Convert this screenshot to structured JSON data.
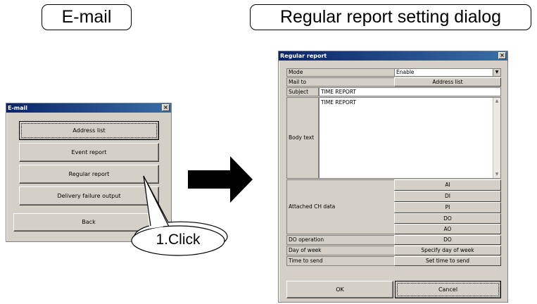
{
  "headings": {
    "left": "E-mail",
    "right": "Regular report setting dialog"
  },
  "email_dialog": {
    "title": "E-mail",
    "buttons": [
      "Address list",
      "Event report",
      "Regular report",
      "Delivery failure output"
    ],
    "back": "Back"
  },
  "callout": {
    "text": "1.Click"
  },
  "regular_dialog": {
    "title": "Regular report",
    "mode_label": "Mode",
    "mode_value": "Enable",
    "mail_to_label": "Mail to",
    "address_list_button": "Address list",
    "subject_label": "Subject",
    "subject_value": "TIME REPORT",
    "body_label": "Body text",
    "body_value": "TIME REPORT",
    "attached_label": "Attached CH data",
    "ch_buttons": [
      "AI",
      "DI",
      "PI",
      "DO",
      "AO"
    ],
    "do_operation_label": "DO operation",
    "do_operation_button": "DO",
    "day_of_week_label": "Day of week",
    "day_of_week_button": "Specify day of week",
    "time_to_send_label": "Time to send",
    "time_to_send_button": "Set time to send",
    "ok": "OK",
    "cancel": "Cancel"
  }
}
